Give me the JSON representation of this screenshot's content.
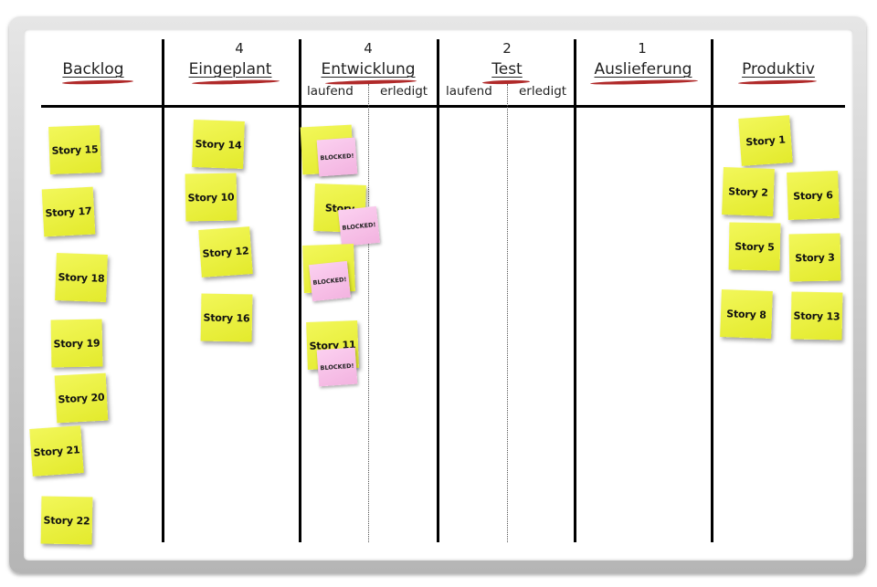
{
  "columns": [
    {
      "wip": "",
      "title": "Backlog"
    },
    {
      "wip": "4",
      "title": "Eingeplant"
    },
    {
      "wip": "4",
      "title": "Entwicklung",
      "sub": [
        "laufend",
        "erledigt"
      ]
    },
    {
      "wip": "2",
      "title": "Test",
      "sub": [
        "laufend",
        "erledigt"
      ]
    },
    {
      "wip": "1",
      "title": "Auslieferung"
    },
    {
      "wip": "",
      "title": "Produktiv"
    }
  ],
  "cards": {
    "backlog": [
      "Story 15",
      "Story 17",
      "Story 18",
      "Story 19",
      "Story 20",
      "Story 21",
      "Story 22"
    ],
    "eingeplant": [
      "Story 14",
      "Story 10",
      "Story 12",
      "Story 16"
    ],
    "entwicklung": [
      "St",
      "Story",
      "St  9",
      "Story 11"
    ],
    "produktiv": [
      "Story 1",
      "Story 2",
      "Story 6",
      "Story 5",
      "Story 3",
      "Story 8",
      "Story 13"
    ]
  },
  "blocked_label": "BLOCKED!",
  "colors": {
    "sticky": "#e8ee34",
    "blocked": "#f7c2e9",
    "underline": "#b02a2a"
  }
}
